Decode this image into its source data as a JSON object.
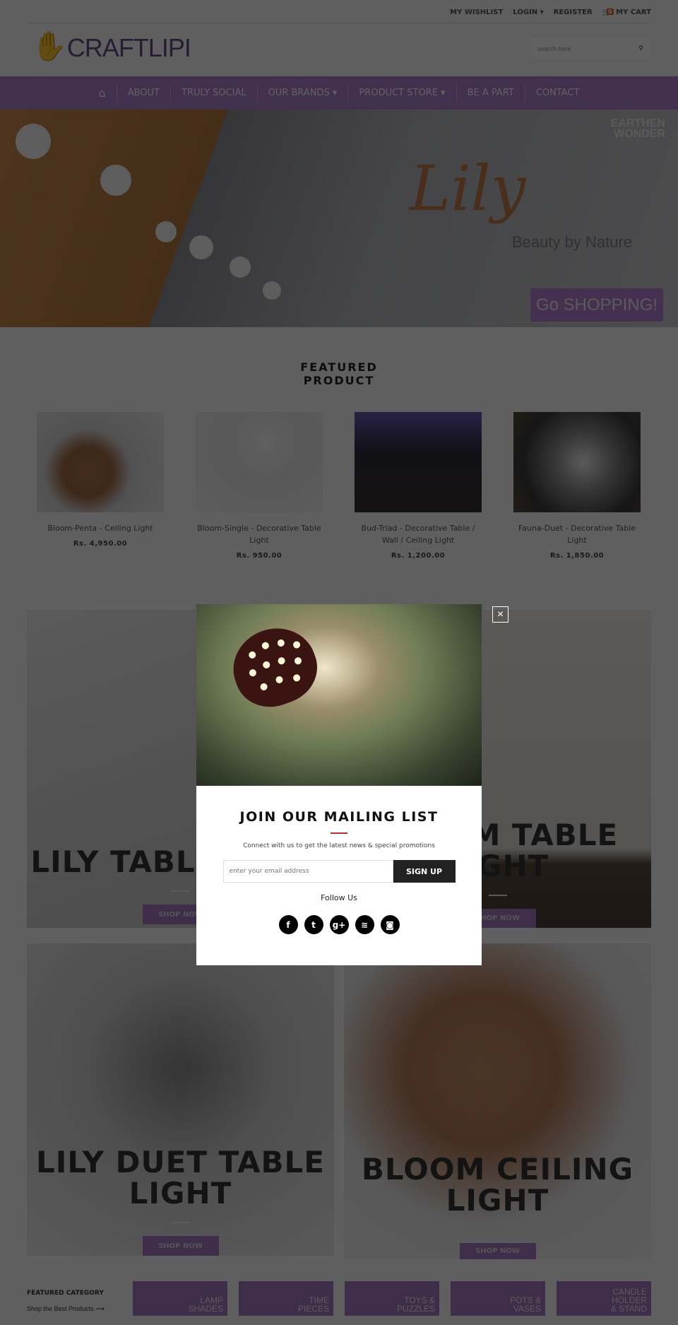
{
  "topbar": {
    "wishlist": "MY WISHLIST",
    "login": "LOGIN",
    "register": "REGISTER",
    "cart_count": "0",
    "cart": "MY CART"
  },
  "header": {
    "logo": "CRAFTLIPI",
    "search_placeholder": "search here"
  },
  "nav": {
    "items": [
      "ABOUT",
      "TRULY SOCIAL",
      "OUR BRANDS",
      "PRODUCT STORE",
      "BE A PART",
      "CONTACT"
    ]
  },
  "hero": {
    "brand_line1": "EARTHEN",
    "brand_line2": "WONDER",
    "product": "Lily",
    "tagline": "Beauty by Nature",
    "cta": "Go SHOPPING!"
  },
  "featured": {
    "title_line1": "FEATURED",
    "title_line2": "PRODUCT",
    "products": [
      {
        "name": "Bloom-Penta - Ceiling Light",
        "price": "Rs. 4,950.00"
      },
      {
        "name": "Bloom-Single - Decorative Table Light",
        "price": "Rs. 950.00"
      },
      {
        "name": "Bud-Triad - Decorative Table / Wall / Ceiling Light",
        "price": "Rs. 1,200.00"
      },
      {
        "name": "Fauna-Duet - Decorative Table Light",
        "price": "Rs. 1,850.00"
      }
    ]
  },
  "banners": [
    {
      "title": "LILY TABLE LIGHT",
      "cta": "SHOP NOW"
    },
    {
      "title": "BLOOM TABLE LIGHT",
      "cta": "SHOP NOW"
    },
    {
      "title": "LILY DUET TABLE LIGHT",
      "cta": "SHOP NOW"
    },
    {
      "title": "BLOOM CEILING LIGHT",
      "cta": "SHOP NOW"
    }
  ],
  "popup": {
    "title": "JOIN OUR MAILING LIST",
    "subtitle": "Connect with us to get the latest news & special promotions",
    "email_placeholder": "enter your email address",
    "signup": "SIGN UP",
    "follow": "Follow Us",
    "close": "×",
    "socials": [
      {
        "icon": "facebook-icon",
        "glyph": "f"
      },
      {
        "icon": "twitter-icon",
        "glyph": "t"
      },
      {
        "icon": "google-plus-icon",
        "glyph": "g+"
      },
      {
        "icon": "rss-icon",
        "glyph": "≋"
      },
      {
        "icon": "instagram-icon",
        "glyph": "◙"
      }
    ]
  },
  "footer": {
    "title": "FEATURED CATEGORY",
    "subtitle": "Shop the Best Products ⟶",
    "categories": [
      [
        "LAMP",
        "SHADES"
      ],
      [
        "TIME",
        "PIECES"
      ],
      [
        "TOYS &",
        "PUZZLES"
      ],
      [
        "POTS &",
        "VASES"
      ],
      [
        "CANDLE",
        "HOLDER",
        "& STAND"
      ]
    ]
  },
  "colors": {
    "accent": "#ae80ce",
    "button": "#a779c2",
    "popup_rule": "#aa3333"
  }
}
